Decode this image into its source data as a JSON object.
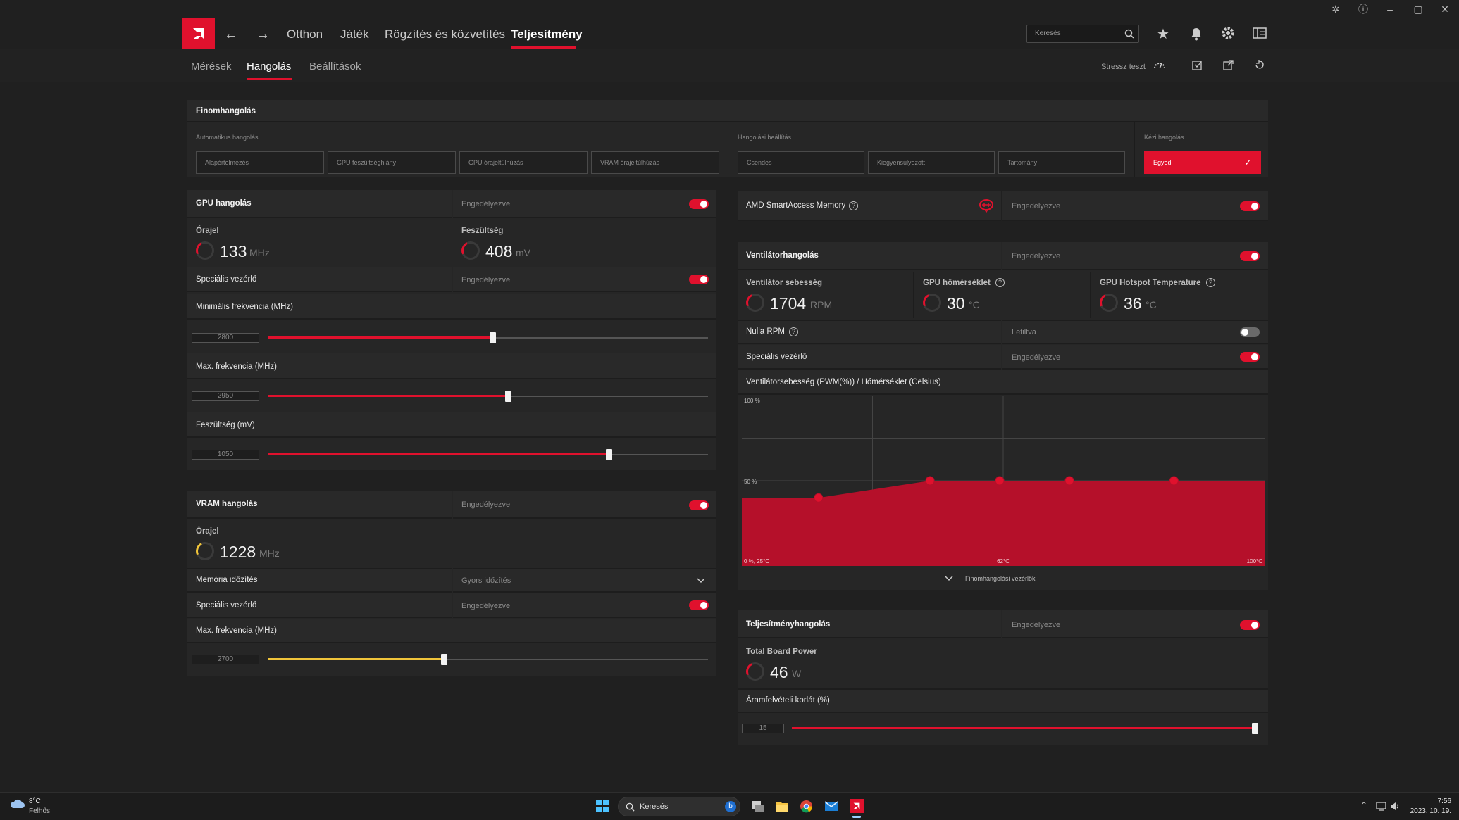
{
  "nav": {
    "items": [
      "Otthon",
      "Játék",
      "Rögzítés és közvetítés",
      "Teljesítmény"
    ],
    "search_placeholder": "Keresés"
  },
  "subnav": {
    "tabs": [
      "Mérések",
      "Hangolás",
      "Beállítások"
    ],
    "stress_test": "Stressz teszt"
  },
  "tuning": {
    "title": "Finomhangolás",
    "auto_label": "Automatikus hangolás",
    "auto_buttons": [
      "Alapértelmezés",
      "GPU feszültséghiány",
      "GPU órajeltúlhúzás",
      "VRAM órajeltúlhúzás"
    ],
    "preset_label": "Hangolási beállítás",
    "preset_buttons": [
      "Csendes",
      "Kiegyensúlyozott",
      "Tartomány"
    ],
    "manual_label": "Kézi hangolás",
    "manual_button": "Egyedi"
  },
  "gpu": {
    "title": "GPU hangolás",
    "enabled": "Engedélyezve",
    "clock_label": "Órajel",
    "clock_value": "133",
    "clock_unit": "MHz",
    "voltage_label": "Feszültség",
    "voltage_value": "408",
    "voltage_unit": "mV",
    "special_label": "Speciális vezérlő",
    "special_state": "Engedélyezve",
    "min_freq_label": "Minimális frekvencia (MHz)",
    "min_freq_value": "2800",
    "min_freq_fraction": 0.51,
    "max_freq_label": "Max. frekvencia (MHz)",
    "max_freq_value": "2950",
    "max_freq_fraction": 0.545,
    "volt_label": "Feszültség (mV)",
    "volt_value": "1050",
    "volt_fraction": 0.775
  },
  "vram": {
    "title": "VRAM hangolás",
    "enabled": "Engedélyezve",
    "clock_label": "Órajel",
    "clock_value": "1228",
    "clock_unit": "MHz",
    "timing_label": "Memória időzítés",
    "timing_value": "Gyors időzítés",
    "special_label": "Speciális vezérlő",
    "special_state": "Engedélyezve",
    "max_freq_label": "Max. frekvencia (MHz)",
    "max_freq_value": "2700",
    "max_freq_fraction": 0.4
  },
  "sam": {
    "title": "AMD SmartAccess Memory",
    "state": "Engedélyezve"
  },
  "fan": {
    "title": "Ventilátorhangolás",
    "enabled": "Engedélyezve",
    "speed_label": "Ventilátor sebesség",
    "speed_value": "1704",
    "speed_unit": "RPM",
    "temp_label": "GPU hőmérséklet",
    "temp_value": "30",
    "temp_unit": "°C",
    "hotspot_label": "GPU Hotspot Temperature",
    "hotspot_value": "36",
    "hotspot_unit": "°C",
    "zero_rpm_label": "Nulla RPM",
    "zero_rpm_state": "Letiltva",
    "special_label": "Speciális vezérlő",
    "special_state": "Engedélyezve",
    "curve_title": "Ventilátorsebesség (PWM(%)) / Hőmérséklet (Celsius)",
    "curve_expand": "Finomhangolási vezérlők"
  },
  "chart_data": {
    "type": "area",
    "x": [
      25,
      36,
      52,
      62,
      72,
      87,
      100
    ],
    "values": [
      40,
      40,
      50,
      50,
      50,
      50,
      50
    ],
    "point_x": [
      36,
      52,
      62,
      72,
      87
    ],
    "ylim": [
      0,
      100
    ],
    "xlim": [
      25,
      100
    ],
    "y_ticks": [
      "100 %",
      "50 %"
    ],
    "x_ticks": [
      "0 %, 25°C",
      "62°C",
      "100°C"
    ],
    "color": "#b5102a"
  },
  "power": {
    "title": "Teljesítményhangolás",
    "enabled": "Engedélyezve",
    "tbp_label": "Total Board Power",
    "tbp_value": "46",
    "tbp_unit": "W",
    "limit_label": "Áramfelvételi korlát (%)",
    "limit_value": "15",
    "limit_fraction": 1.0
  },
  "taskbar": {
    "weather_temp": "8°C",
    "weather_text": "Felhős",
    "search": "Keresés",
    "time": "7:56",
    "date": "2023. 10. 19."
  }
}
